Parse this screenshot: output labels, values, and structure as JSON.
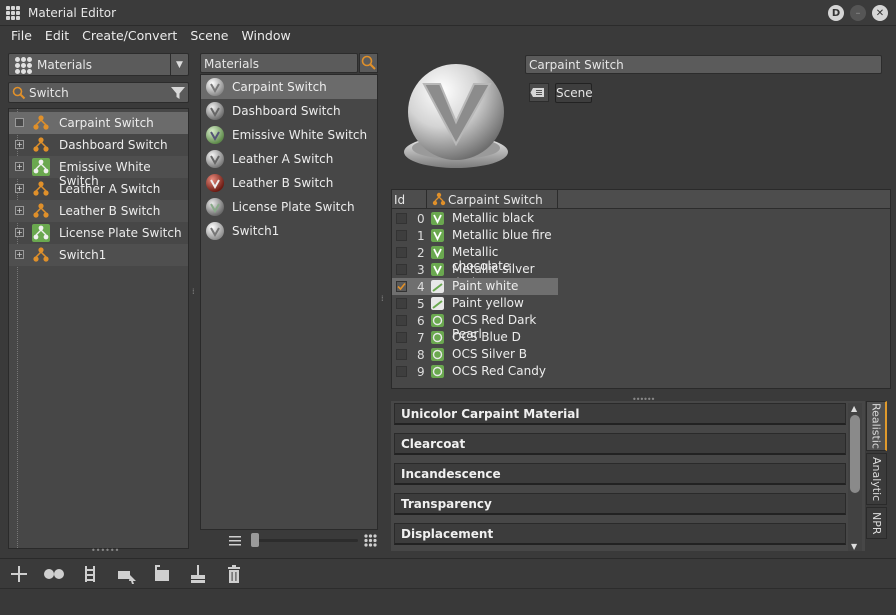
{
  "window": {
    "title": "Material Editor"
  },
  "menubar": {
    "items": [
      "File",
      "Edit",
      "Create/Convert",
      "Scene",
      "Window"
    ]
  },
  "library": {
    "dropdown_label": "Materials",
    "search_value": "Switch",
    "tree": [
      {
        "label": "Carpaint Switch",
        "selected": true,
        "icon": "switch-orange"
      },
      {
        "label": "Dashboard Switch",
        "selected": false,
        "icon": "switch-orange"
      },
      {
        "label": "Emissive White Switch",
        "selected": false,
        "icon": "switch-green"
      },
      {
        "label": "Leather A Switch",
        "selected": false,
        "icon": "switch-orange"
      },
      {
        "label": "Leather B Switch",
        "selected": false,
        "icon": "switch-orange"
      },
      {
        "label": "License Plate Switch",
        "selected": false,
        "icon": "switch-green"
      },
      {
        "label": "Switch1",
        "selected": false,
        "icon": "switch-orange"
      }
    ]
  },
  "materials_list": {
    "header": "Materials",
    "items": [
      {
        "label": "Carpaint Switch",
        "selected": true,
        "ball": "#d0d0d0"
      },
      {
        "label": "Dashboard Switch",
        "selected": false,
        "ball": "#b8b8b8"
      },
      {
        "label": "Emissive White Switch",
        "selected": false,
        "ball": "#9bbf8a"
      },
      {
        "label": "Leather A Switch",
        "selected": false,
        "ball": "#c8c8c8"
      },
      {
        "label": "Leather B Switch",
        "selected": false,
        "ball": "#b33a2e"
      },
      {
        "label": "License Plate Switch",
        "selected": false,
        "ball": "#a8a8a8"
      },
      {
        "label": "Switch1",
        "selected": false,
        "ball": "#dcdcdc"
      }
    ]
  },
  "editor": {
    "name_value": "Carpaint Switch",
    "scene_button": "Scene",
    "table": {
      "col_id": "Id",
      "col_name": "Carpaint Switch",
      "rows": [
        {
          "id": "0",
          "label": "Metallic black",
          "checked": false,
          "selected": false,
          "icon": "material-green"
        },
        {
          "id": "1",
          "label": "Metallic blue fire",
          "checked": false,
          "selected": false,
          "icon": "material-green"
        },
        {
          "id": "2",
          "label": "Metallic chocolate",
          "checked": false,
          "selected": false,
          "icon": "material-green"
        },
        {
          "id": "3",
          "label": "Metallic silver dark",
          "checked": false,
          "selected": false,
          "icon": "material-green"
        },
        {
          "id": "4",
          "label": "Paint white",
          "checked": true,
          "selected": true,
          "icon": "material-light"
        },
        {
          "id": "5",
          "label": "Paint yellow",
          "checked": false,
          "selected": false,
          "icon": "material-light"
        },
        {
          "id": "6",
          "label": "OCS Red Dark Pearl",
          "checked": false,
          "selected": false,
          "icon": "material-green-round"
        },
        {
          "id": "7",
          "label": "OCS Blue D",
          "checked": false,
          "selected": false,
          "icon": "material-green-round"
        },
        {
          "id": "8",
          "label": "OCS Silver B",
          "checked": false,
          "selected": false,
          "icon": "material-green-round"
        },
        {
          "id": "9",
          "label": "OCS Red Candy",
          "checked": false,
          "selected": false,
          "icon": "material-green-round"
        }
      ]
    },
    "sections": [
      "Unicolor Carpaint Material",
      "Clearcoat",
      "Incandescence",
      "Transparency",
      "Displacement"
    ],
    "render_tabs": [
      {
        "label": "Realistic",
        "active": true
      },
      {
        "label": "Analytic",
        "active": false
      },
      {
        "label": "NPR",
        "active": false
      }
    ]
  },
  "toolbar": {
    "tools": [
      "add-icon",
      "duplicate-icon",
      "assign-icon",
      "pick-icon",
      "bucket-icon",
      "brush-icon",
      "delete-icon"
    ]
  },
  "colors": {
    "accent": "#e09a2c",
    "switch_orange": "#e0902a",
    "material_green": "#6aa84f"
  }
}
